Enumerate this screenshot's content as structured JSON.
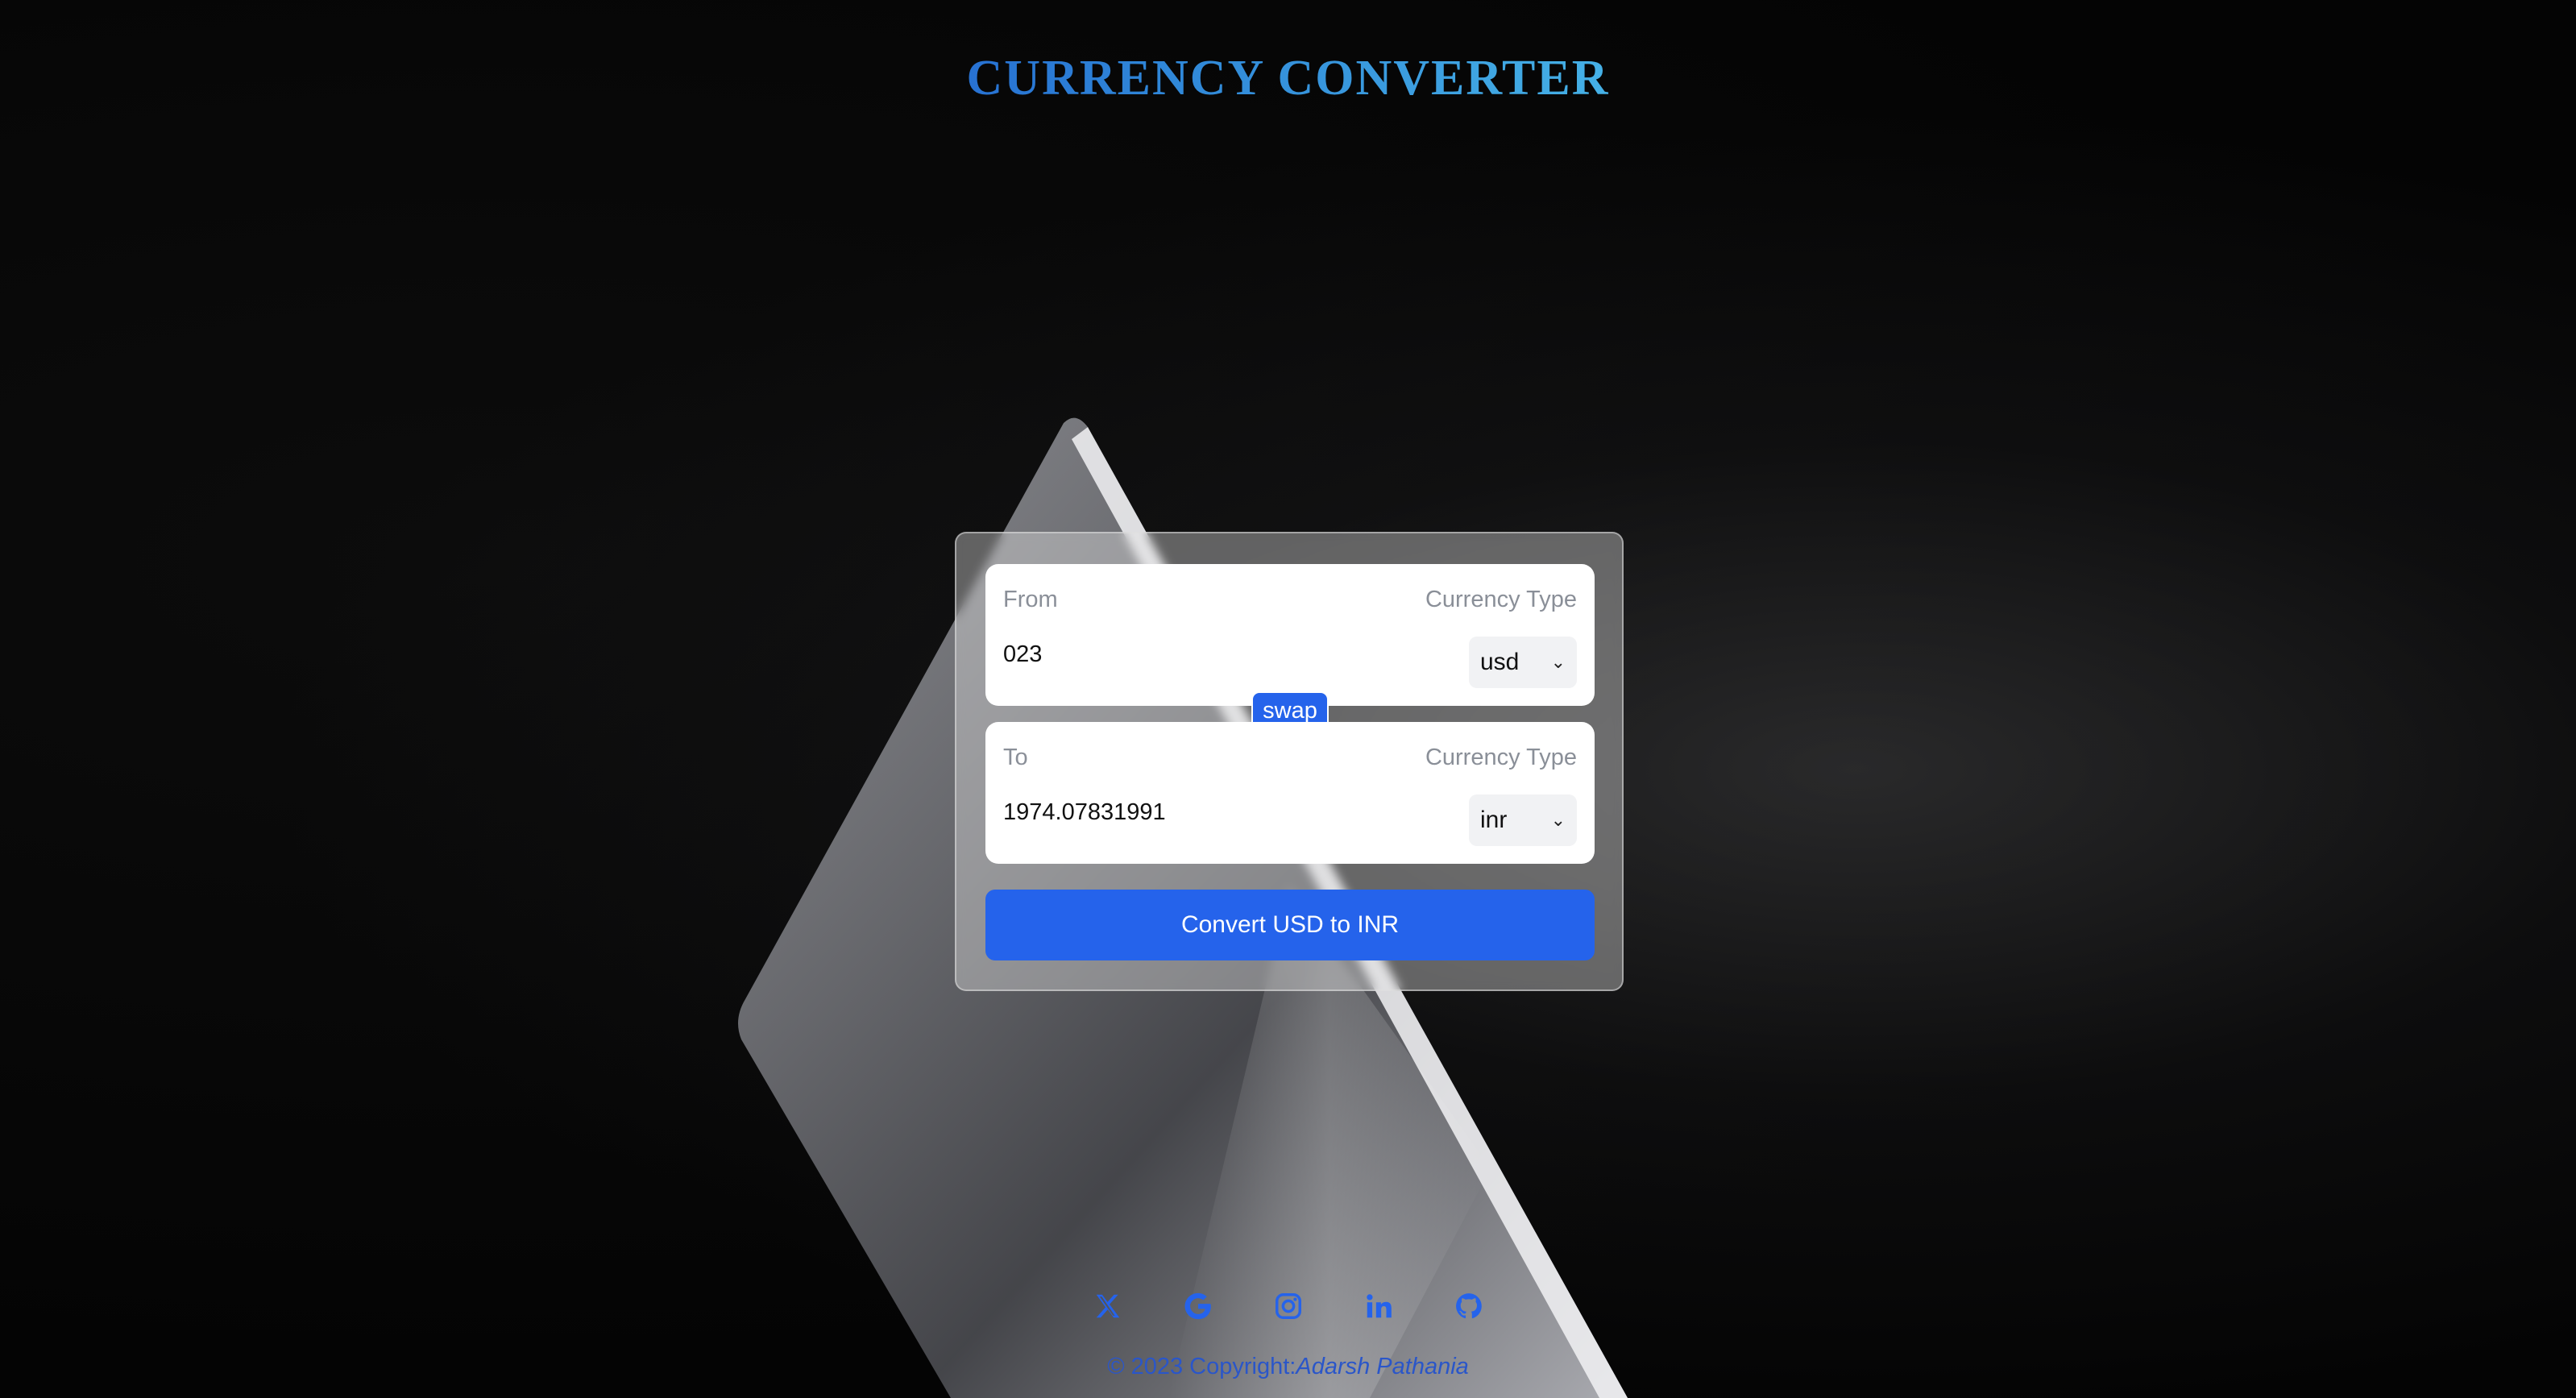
{
  "header": {
    "title": "CURRENCY CONVERTER"
  },
  "converter": {
    "from": {
      "label": "From",
      "currency_type_label": "Currency Type",
      "amount": "023",
      "currency": "usd"
    },
    "swap_label": "swap",
    "to": {
      "label": "To",
      "currency_type_label": "Currency Type",
      "amount": "1974.07831991",
      "currency": "inr"
    },
    "convert_label": "Convert USD to INR"
  },
  "socials": [
    {
      "icon": "x-twitter-icon"
    },
    {
      "icon": "google-icon"
    },
    {
      "icon": "instagram-icon"
    },
    {
      "icon": "linkedin-icon"
    },
    {
      "icon": "github-icon"
    }
  ],
  "footer": {
    "copyright": "© 2023 Copyright:",
    "author": "Adarsh Pathania"
  },
  "colors": {
    "accent": "#2563eb",
    "background": "#050505"
  }
}
